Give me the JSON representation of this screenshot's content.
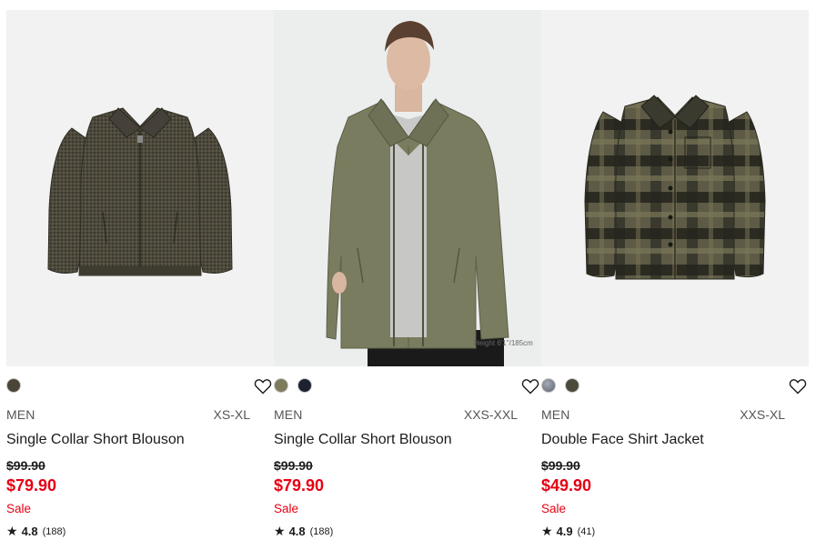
{
  "products": [
    {
      "gender": "MEN",
      "sizes": "XS-XL",
      "name": "Single Collar Short Blouson",
      "original_price": "$99.90",
      "sale_price": "$79.90",
      "sale_label": "Sale",
      "rating": "4.8",
      "review_count": "(188)",
      "colors": [
        "#4a4536"
      ],
      "image_icon": "jacket-flat-houndstooth"
    },
    {
      "gender": "MEN",
      "sizes": "XXS-XXL",
      "name": "Single Collar Short Blouson",
      "original_price": "$99.90",
      "sale_price": "$79.90",
      "sale_label": "Sale",
      "rating": "4.8",
      "review_count": "(188)",
      "colors": [
        "#7c7b5e",
        "#1d2230"
      ],
      "image_icon": "model-wearing-jacket",
      "image_caption": "Height 6'1\"/185cm"
    },
    {
      "gender": "MEN",
      "sizes": "XXS-XL",
      "name": "Double Face Shirt Jacket",
      "original_price": "$99.90",
      "sale_price": "$49.90",
      "sale_label": "Sale",
      "rating": "4.9",
      "review_count": "(41)",
      "colors": [
        "#6f7684",
        "#4c4a3a"
      ],
      "image_icon": "shirt-jacket-plaid"
    }
  ],
  "accent_color": "#e60012"
}
